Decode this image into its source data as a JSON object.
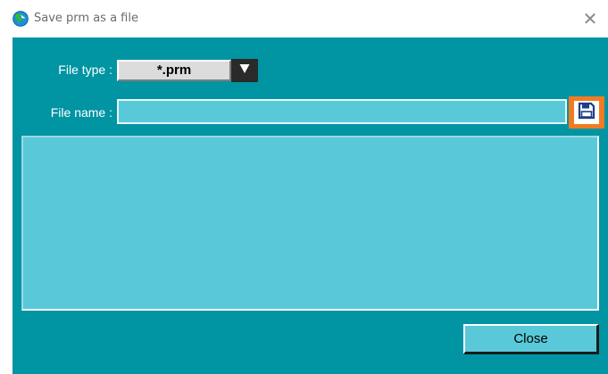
{
  "window": {
    "title": "Save prm as a file",
    "close_glyph": "✕",
    "app_icon": "app-logo-icon"
  },
  "form": {
    "file_type_label": "File type :",
    "file_type_value": "*.prm",
    "file_type_dropdown_icon": "triangle-down-icon",
    "file_name_label": "File name :",
    "file_name_value": "",
    "save_icon": "floppy-disk-icon"
  },
  "file_list": {
    "items": []
  },
  "buttons": {
    "close_label": "Close"
  },
  "colors": {
    "background": "#0194a3",
    "field": "#59c9d9",
    "accent": "#f27b21"
  }
}
